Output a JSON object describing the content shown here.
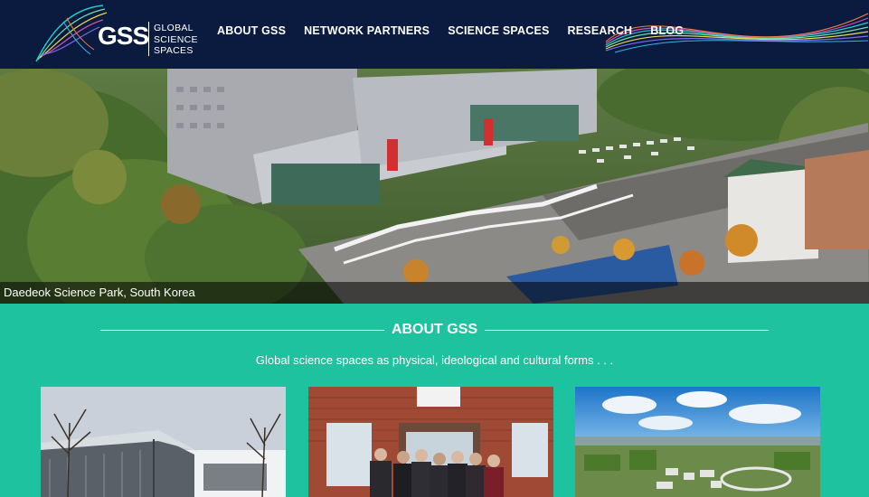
{
  "brand": {
    "logo_text": "GSS",
    "subtitle_lines": [
      "GLOBAL",
      "SCIENCE",
      "SPACES"
    ]
  },
  "nav": {
    "items": [
      {
        "label": "ABOUT GSS"
      },
      {
        "label": "NETWORK PARTNERS"
      },
      {
        "label": "SCIENCE SPACES"
      },
      {
        "label": "RESEARCH"
      },
      {
        "label": "BLOG"
      }
    ]
  },
  "hero": {
    "caption": "Daedeok Science Park, South Korea"
  },
  "about": {
    "title": "ABOUT GSS",
    "subtitle": "Global science spaces as physical, ideological and cultural forms . . ."
  },
  "colors": {
    "header_bg": "#0b1b3f",
    "section_bg": "#1ec29e",
    "text": "#ffffff"
  }
}
